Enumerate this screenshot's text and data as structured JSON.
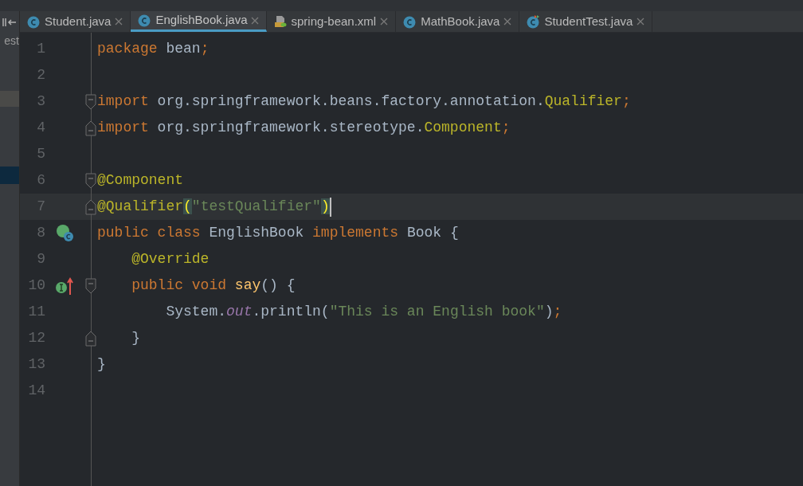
{
  "sidebar": {
    "fragment": "est"
  },
  "tabs": [
    {
      "label": "Student.java",
      "kind": "class",
      "selected": false
    },
    {
      "label": "EnglishBook.java",
      "kind": "class",
      "selected": true
    },
    {
      "label": "spring-bean.xml",
      "kind": "xml",
      "selected": false
    },
    {
      "label": "MathBook.java",
      "kind": "class",
      "selected": false
    },
    {
      "label": "StudentTest.java",
      "kind": "test",
      "selected": false
    }
  ],
  "editor": {
    "lines": [
      {
        "number": "1",
        "tokens": [
          {
            "text": "package",
            "kind": "kw"
          },
          {
            "text": " bean",
            "kind": "plain"
          },
          {
            "text": ";",
            "kind": "kw"
          }
        ]
      },
      {
        "number": "2"
      },
      {
        "number": "3",
        "fold": {
          "kind": "start"
        },
        "tokens": [
          {
            "text": "import",
            "kind": "kw"
          },
          {
            "text": " org.springframework.beans.factory.annotation.",
            "kind": "plain"
          },
          {
            "text": "Qualifier",
            "kind": "ann"
          },
          {
            "text": ";",
            "kind": "kw"
          }
        ]
      },
      {
        "number": "4",
        "fold": {
          "kind": "end"
        },
        "tokens": [
          {
            "text": "import",
            "kind": "kw"
          },
          {
            "text": " org.springframework.stereotype.",
            "kind": "plain"
          },
          {
            "text": "Component",
            "kind": "ann"
          },
          {
            "text": ";",
            "kind": "kw"
          }
        ]
      },
      {
        "number": "5"
      },
      {
        "number": "6",
        "fold": {
          "kind": "start"
        },
        "tokens": [
          {
            "text": "@Component",
            "kind": "ann"
          }
        ]
      },
      {
        "number": "7",
        "fold": {
          "kind": "end"
        },
        "current": true,
        "tokens": [
          {
            "text": "@Qualifier",
            "kind": "ann"
          },
          {
            "text": "(",
            "kind": "match"
          },
          {
            "text": "\"testQualifier\"",
            "kind": "str"
          },
          {
            "text": ")",
            "kind": "match"
          }
        ]
      },
      {
        "number": "8",
        "marker": {
          "kind": "class"
        },
        "tokens": [
          {
            "text": "public class ",
            "kind": "kw"
          },
          {
            "text": "EnglishBook ",
            "kind": "plain"
          },
          {
            "text": "implements ",
            "kind": "kw"
          },
          {
            "text": "Book {",
            "kind": "plain"
          }
        ]
      },
      {
        "number": "9",
        "tokens": [
          {
            "text": "    @Override",
            "kind": "ann"
          }
        ]
      },
      {
        "number": "10",
        "marker": {
          "kind": "implements"
        },
        "fold": {
          "kind": "start"
        },
        "tokens": [
          {
            "text": "    public void ",
            "kind": "kw"
          },
          {
            "text": "say",
            "kind": "method"
          },
          {
            "text": "() {",
            "kind": "plain"
          }
        ]
      },
      {
        "number": "11",
        "tokens": [
          {
            "text": "        System.",
            "kind": "plain"
          },
          {
            "text": "out",
            "kind": "field"
          },
          {
            "text": ".println(",
            "kind": "plain"
          },
          {
            "text": "\"This is an English book\"",
            "kind": "str"
          },
          {
            "text": ")",
            "kind": "plain"
          },
          {
            "text": ";",
            "kind": "kw"
          }
        ]
      },
      {
        "number": "12",
        "fold": {
          "kind": "end"
        },
        "tokens": [
          {
            "text": "    }",
            "kind": "plain"
          }
        ]
      },
      {
        "number": "13",
        "tokens": [
          {
            "text": "}",
            "kind": "plain"
          }
        ]
      },
      {
        "number": "14"
      }
    ]
  }
}
